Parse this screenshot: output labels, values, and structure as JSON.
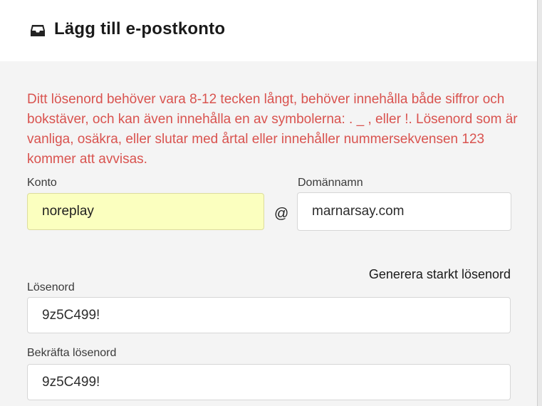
{
  "dialog": {
    "title": "Lägg till e-postkonto",
    "icon": "inbox-icon"
  },
  "warning_text": "Ditt lösenord behöver vara 8-12 tecken långt, behöver innehålla både siffror och bokstäver, och kan även innehålla en av symbolerna: . _ , eller !. Lösenord som är vanliga, osäkra, eller slutar med årtal eller innehåller nummersekvensen 123 kommer att avvisas.",
  "account": {
    "label": "Konto",
    "value": "noreplay"
  },
  "at_symbol": "@",
  "domain": {
    "label": "Domännamn",
    "value": "marnarsay.com"
  },
  "generate_password_label": "Generera starkt lösenord",
  "password": {
    "label": "Lösenord",
    "value": "9z5C499!"
  },
  "confirm_password": {
    "label": "Bekräfta lösenord",
    "value": "9z5C499!"
  },
  "colors": {
    "warning": "#d9534f",
    "autofill_background": "#fbffbf",
    "dialog_background": "#f4f4f4"
  }
}
